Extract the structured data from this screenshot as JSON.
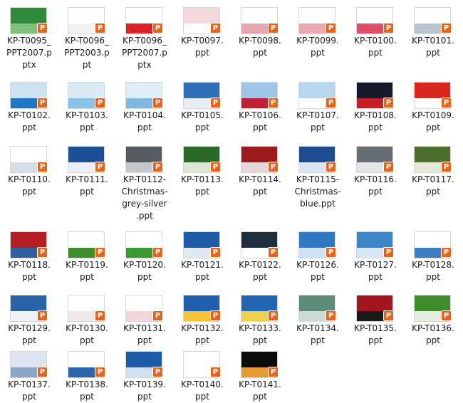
{
  "files": [
    {
      "label": "KP-T0095_\nPPT2007.p\nptx",
      "colors": [
        "#2f8a3c",
        "#7fc07a"
      ]
    },
    {
      "label": "KP-T0096_\nPPT2003.p\npt",
      "colors": [
        "#ffffff",
        "#f2f2f2"
      ]
    },
    {
      "label": "KP-T0096_\nPPT2007.p\nptx",
      "colors": [
        "#ffffff",
        "#d8232a"
      ]
    },
    {
      "label": "KP-T0097.\nppt",
      "colors": [
        "#f6d9dc",
        "#ffffff"
      ]
    },
    {
      "label": "KP-T0098.\nppt",
      "colors": [
        "#ffffff",
        "#e6a6ae"
      ]
    },
    {
      "label": "KP-T0099.\nppt",
      "colors": [
        "#ffffff",
        "#e9aab4"
      ]
    },
    {
      "label": "KP-T0100.\nppt",
      "colors": [
        "#ffffff",
        "#e14c68"
      ]
    },
    {
      "label": "KP-T0101.\nppt",
      "colors": [
        "#ffffff",
        "#b9c4ce"
      ]
    },
    {
      "label": "KP-T0102.\nppt",
      "colors": [
        "#cde3f3",
        "#1e77c4"
      ]
    },
    {
      "label": "KP-T0103.\nppt",
      "colors": [
        "#dcebf8",
        "#8bc2e8"
      ]
    },
    {
      "label": "KP-T0104.\nppt",
      "colors": [
        "#ddeef9",
        "#7db8e0"
      ]
    },
    {
      "label": "KP-T0105.\nppt",
      "colors": [
        "#2e6fb5",
        "#e7eef5"
      ]
    },
    {
      "label": "KP-T0106.\nppt",
      "colors": [
        "#9fc6e6",
        "#c2203a"
      ]
    },
    {
      "label": "KP-T0107.\nppt",
      "colors": [
        "#b8d6ee",
        "#ffffff"
      ]
    },
    {
      "label": "KP-T0108.\nppt",
      "colors": [
        "#161a2a",
        "#c81e27"
      ]
    },
    {
      "label": "KP-T0109.\nppt",
      "colors": [
        "#d9261c",
        "#ffffff"
      ]
    },
    {
      "label": "KP-T0110.\nppt",
      "colors": [
        "#ffffff",
        "#d5dde6"
      ]
    },
    {
      "label": "KP-T0111.\nppt",
      "colors": [
        "#1d4f94",
        "#eaf0f7"
      ]
    },
    {
      "label": "KP-T0112-\nChristmas-\ngrey-silver\n.ppt",
      "colors": [
        "#555b60",
        "#c5c9cc"
      ]
    },
    {
      "label": "KP-T0113.\nppt",
      "colors": [
        "#2d6a2a",
        "#dbe6d6"
      ]
    },
    {
      "label": "KP-T0114.\nppt",
      "colors": [
        "#9c1b1e",
        "#e8d7d7"
      ]
    },
    {
      "label": "KP-T0115-\nChristmas-\nblue.ppt",
      "colors": [
        "#1c4c8f",
        "#dce6f2"
      ]
    },
    {
      "label": "KP-T0116.\nppt",
      "colors": [
        "#676d72",
        "#e3e5e6"
      ]
    },
    {
      "label": "KP-T0117.\nppt",
      "colors": [
        "#4c6f2e",
        "#e3eadb"
      ]
    },
    {
      "label": "KP-T0118.\nppt",
      "colors": [
        "#b51f23",
        "#2e5fa3"
      ]
    },
    {
      "label": "KP-T0119.\nppt",
      "colors": [
        "#ffffff",
        "#3e8f2c"
      ]
    },
    {
      "label": "KP-T0120.\nppt",
      "colors": [
        "#ffffff",
        "#3a9a2f"
      ]
    },
    {
      "label": "KP-T0121.\nppt",
      "colors": [
        "#1d5aa8",
        "#dfe9f4"
      ]
    },
    {
      "label": "KP-T0122.\nppt",
      "colors": [
        "#1f2e3c",
        "#ffffff"
      ]
    },
    {
      "label": "KP-T0126.\nppt",
      "colors": [
        "#2f7ac2",
        "#cfe2f3"
      ]
    },
    {
      "label": "KP-T0127.\nppt",
      "colors": [
        "#3b85c9",
        "#d6e6f4"
      ]
    },
    {
      "label": "KP-T0128.\nppt",
      "colors": [
        "#ffffff",
        "#3c7cc2"
      ]
    },
    {
      "label": "KP-T0129.\nppt",
      "colors": [
        "#2a62a8",
        "#eef3f8"
      ]
    },
    {
      "label": "KP-T0130.\nppt",
      "colors": [
        "#ffffff",
        "#f0e8ea"
      ]
    },
    {
      "label": "KP-T0131.\nppt",
      "colors": [
        "#ffffff",
        "#f3d6dc"
      ]
    },
    {
      "label": "KP-T0132.\nppt",
      "colors": [
        "#1f5fae",
        "#f3c43a"
      ]
    },
    {
      "label": "KP-T0133.\nppt",
      "colors": [
        "#2566b3",
        "#f1d14a"
      ]
    },
    {
      "label": "KP-T0134.\nppt",
      "colors": [
        "#5f8c7a",
        "#cfdcd6"
      ]
    },
    {
      "label": "KP-T0135.\nppt",
      "colors": [
        "#a1161f",
        "#1a1a1a"
      ]
    },
    {
      "label": "KP-T0136.\nppt",
      "colors": [
        "#3f8a2a",
        "#e5ede0"
      ]
    },
    {
      "label": "KP-T0137.\nppt",
      "colors": [
        "#dde6f0",
        "#8aa6c6"
      ]
    },
    {
      "label": "KP-T0138.\nppt",
      "colors": [
        "#ffffff",
        "#2a65ad"
      ]
    },
    {
      "label": "KP-T0139.\nppt",
      "colors": [
        "#1f5ca7",
        "#cfe0f1"
      ]
    },
    {
      "label": "KP-T0140.\nppt",
      "colors": [
        "#ffffff",
        "#ffffff"
      ]
    },
    {
      "label": "KP-T0141.\nppt",
      "colors": [
        "#0c0c0c",
        "#e89b35"
      ]
    }
  ],
  "badge_icon": "powerpoint-icon",
  "badge_glyph": "P",
  "badge_color": "#e8641b"
}
